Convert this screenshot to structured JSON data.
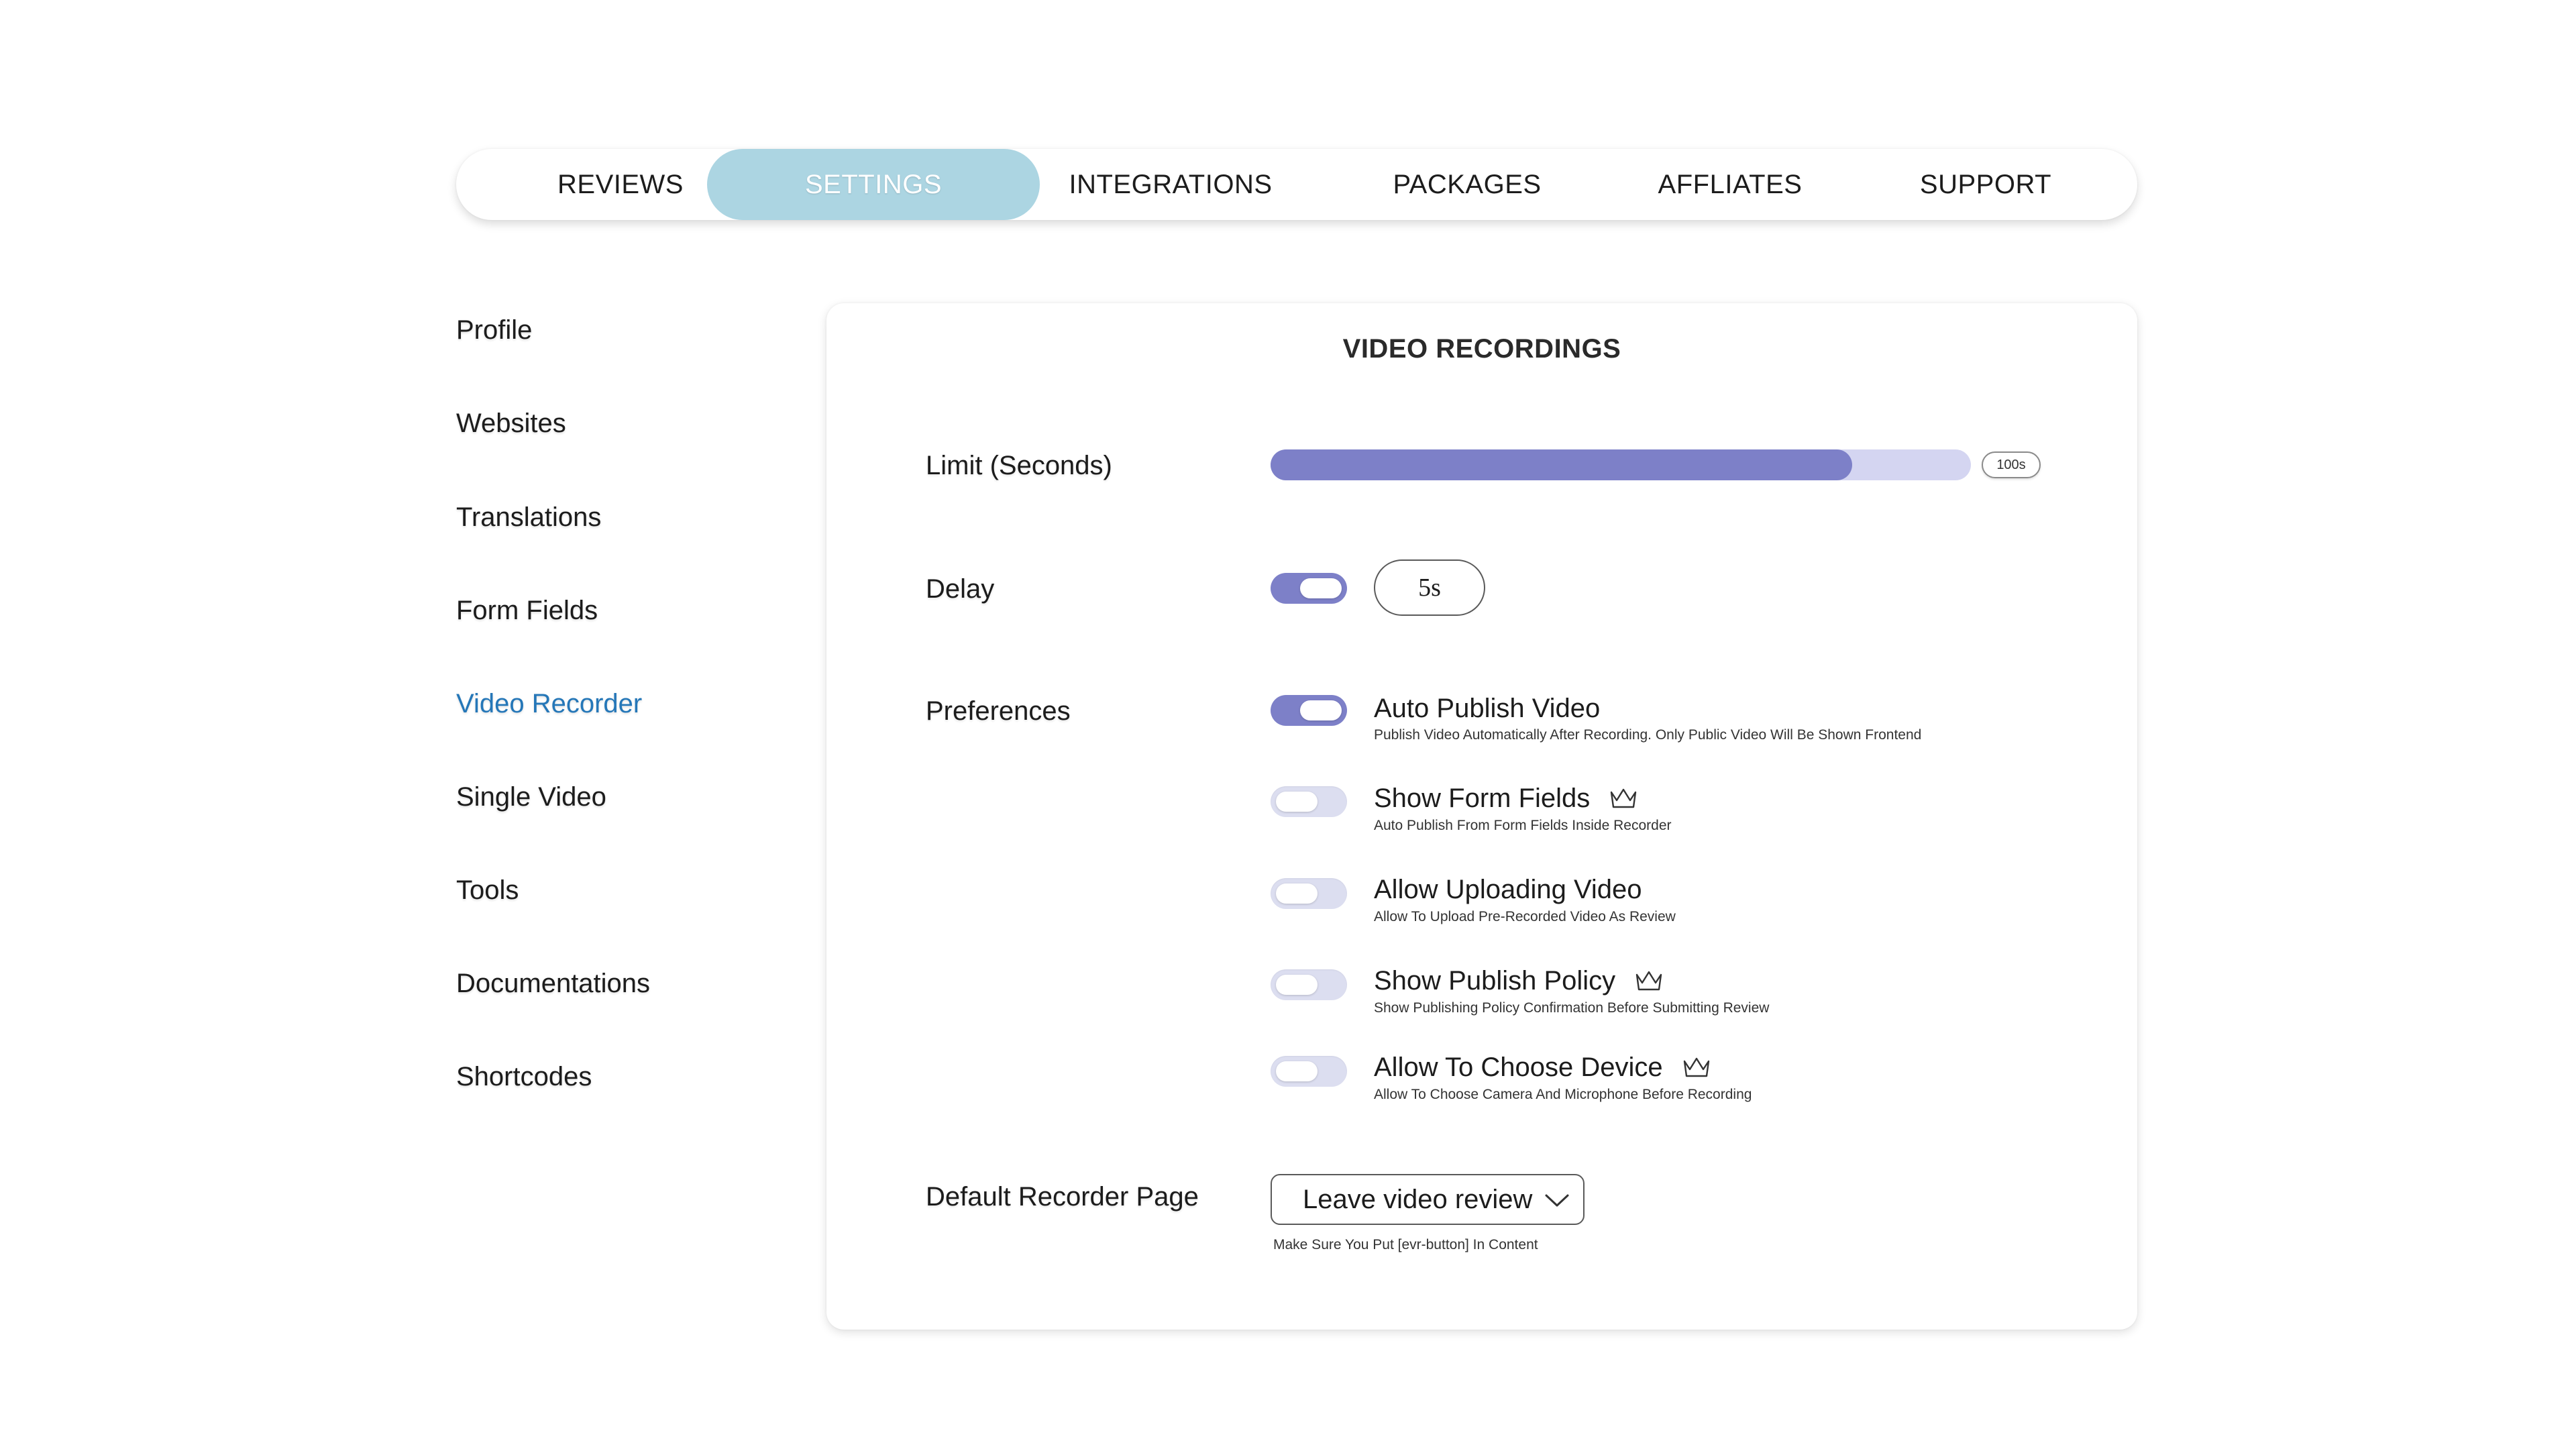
{
  "tabs": [
    {
      "label": "REVIEWS",
      "active": false
    },
    {
      "label": "SETTINGS",
      "active": true
    },
    {
      "label": "INTEGRATIONS",
      "active": false
    },
    {
      "label": "PACKAGES",
      "active": false
    },
    {
      "label": "AFFLIATES",
      "active": false
    },
    {
      "label": "SUPPORT",
      "active": false
    }
  ],
  "sidebar": {
    "items": [
      {
        "label": "Profile"
      },
      {
        "label": "Websites"
      },
      {
        "label": "Translations"
      },
      {
        "label": "Form Fields"
      },
      {
        "label": "Video Recorder",
        "active": true
      },
      {
        "label": "Single Video"
      },
      {
        "label": "Tools"
      },
      {
        "label": "Documentations"
      },
      {
        "label": "Shortcodes"
      }
    ]
  },
  "card": {
    "title": "VIDEO RECORDINGS",
    "limit": {
      "label": "Limit (Seconds)",
      "value_label": "100s",
      "fill_fraction": 0.83
    },
    "delay": {
      "label": "Delay",
      "enabled": true,
      "value": "5s"
    },
    "preferences": {
      "label": "Preferences",
      "items": [
        {
          "title": "Auto Publish Video",
          "desc": "Publish Video Automatically After Recording. Only Public Video Will Be Shown Frontend",
          "on": true,
          "premium": false
        },
        {
          "title": "Show Form Fields",
          "desc": "Auto Publish From Form Fields Inside Recorder",
          "on": false,
          "premium": true
        },
        {
          "title": "Allow Uploading Video",
          "desc": "Allow To Upload Pre-Recorded Video As Review",
          "on": false,
          "premium": false
        },
        {
          "title": "Show Publish Policy",
          "desc": "Show Publishing Policy Confirmation Before Submitting Review",
          "on": false,
          "premium": true
        },
        {
          "title": "Allow To Choose Device",
          "desc": "Allow To Choose  Camera And Microphone Before Recording",
          "on": false,
          "premium": true
        }
      ]
    },
    "default_page": {
      "label": "Default Recorder Page",
      "selected": "Leave video review",
      "hint": "Make Sure You Put [evr-button] In Content"
    }
  },
  "icons": {
    "premium": "crown-icon",
    "dropdown": "chevron-down-icon"
  },
  "colors": {
    "accent": "#7d80c8",
    "track": "#d4d5f1",
    "active_tab": "#acd5e2",
    "active_link": "#2577b8"
  }
}
